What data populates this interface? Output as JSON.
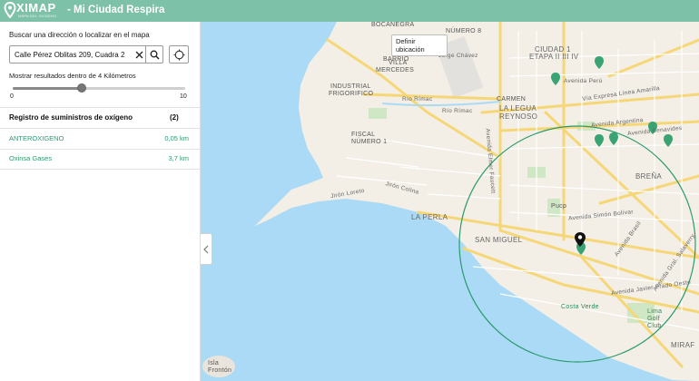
{
  "header": {
    "logo_text": "XIMAP",
    "logo_subtitle": "MAPA DEL OXÍGENO",
    "title": "- Mi Ciudad Respira",
    "brand_color": "#7cc1a8"
  },
  "search": {
    "label": "Buscar una dirección o localizar en el mapa",
    "value": "Calle Pérez Oblitas 209, Cuadra 2"
  },
  "range": {
    "label": "Mostrar resultados dentro de 4 Kilómetros",
    "min_label": "0",
    "max_label": "10",
    "value": 4,
    "min": 0,
    "max": 10
  },
  "registry": {
    "title": "Registro de suministros de oxígeno",
    "count": "(2)",
    "results": [
      {
        "name": "ANTEROXIGENO",
        "distance": "0,05 km"
      },
      {
        "name": "Oxinsa Gases",
        "distance": "3,7 km"
      }
    ]
  },
  "map": {
    "tooltip": "Definir ubicación",
    "accent_color": "#2a9a6d",
    "labels": {
      "bocanegra": "BOCANEGRA",
      "barrio": "BARRIO",
      "villa": "VILLA",
      "mercedes": "MERCEDES",
      "industrial": "INDUSTRIAL",
      "frigorifico": "FRIGORIFICO",
      "rio_rimac_1": "Río Rímac",
      "rio_rimac_2": "Río Rímac",
      "carmen": "CARMEN",
      "la_legua": "LA LEGUA",
      "reynoso": "REYNOSO",
      "fiscal": "FISCAL",
      "numero_1": "NÚMERO 1",
      "jiron_loreto": "Jirón Loreto",
      "jiron_colina": "Jirón Colina",
      "la_perla": "LA PERLA",
      "san_miguel": "SAN MIGUEL",
      "pucp": "Pucp",
      "brena": "BREÑA",
      "av_peru": "Avenida Perú",
      "via_expresa": "Vía Expresa Línea Amarilla",
      "av_argentina": "Avenida Argentina",
      "av_benavides": "Avenida Benavides",
      "av_faucett": "Avenida Elmer Faucett",
      "av_bolivar": "Avenida Simón Bolívar",
      "av_brasil": "Avenida Brasil",
      "av_salaverry": "Avenida Gral. Salaverry",
      "av_prado": "Avenida Javier Prado Oeste",
      "costa_verde": "Costa Verde",
      "lima_golf": "Lima Golf Club",
      "isla_fronton": "Isla Frontón",
      "miraf": "MIRAF",
      "ciudad_1": "CIUDAD 1",
      "etapa": "ETAPA II III IV",
      "ciudad_num_8": "NÚMERO 8",
      "jorge_chavez": "Jorge Chávez"
    }
  }
}
